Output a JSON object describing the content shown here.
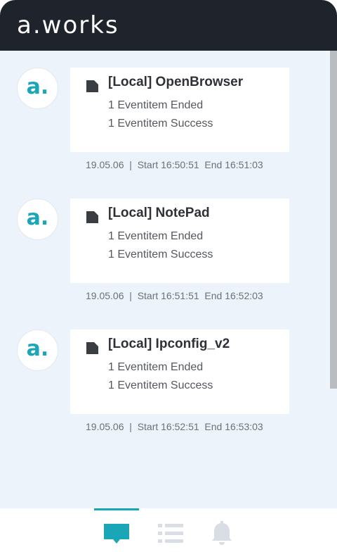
{
  "header": {
    "logo": "a.works"
  },
  "entries": [
    {
      "avatar": "a.",
      "title": "[Local] OpenBrowser",
      "line1": "1 Eventitem Ended",
      "line2": "1 Eventitem Success",
      "meta": "19.05.06  |  Start 16:50:51  End 16:51:03"
    },
    {
      "avatar": "a.",
      "title": "[Local] NotePad",
      "line1": "1 Eventitem Ended",
      "line2": "1 Eventitem Success",
      "meta": "19.05.06  |  Start 16:51:51  End 16:52:03"
    },
    {
      "avatar": "a.",
      "title": "[Local] Ipconfig_v2",
      "line1": "1 Eventitem Ended",
      "line2": "1 Eventitem Success",
      "meta": "19.05.06  |  Start 16:52:51  End 16:53:03"
    }
  ],
  "nav": {
    "items": [
      {
        "icon": "chat-icon",
        "active": true
      },
      {
        "icon": "list-icon",
        "active": false
      },
      {
        "icon": "bell-icon",
        "active": false
      }
    ]
  },
  "colors": {
    "header_bg": "#1f232b",
    "accent": "#1aa6b7",
    "feed_bg": "#edf3fb",
    "inactive_icon": "#d9dde4"
  }
}
